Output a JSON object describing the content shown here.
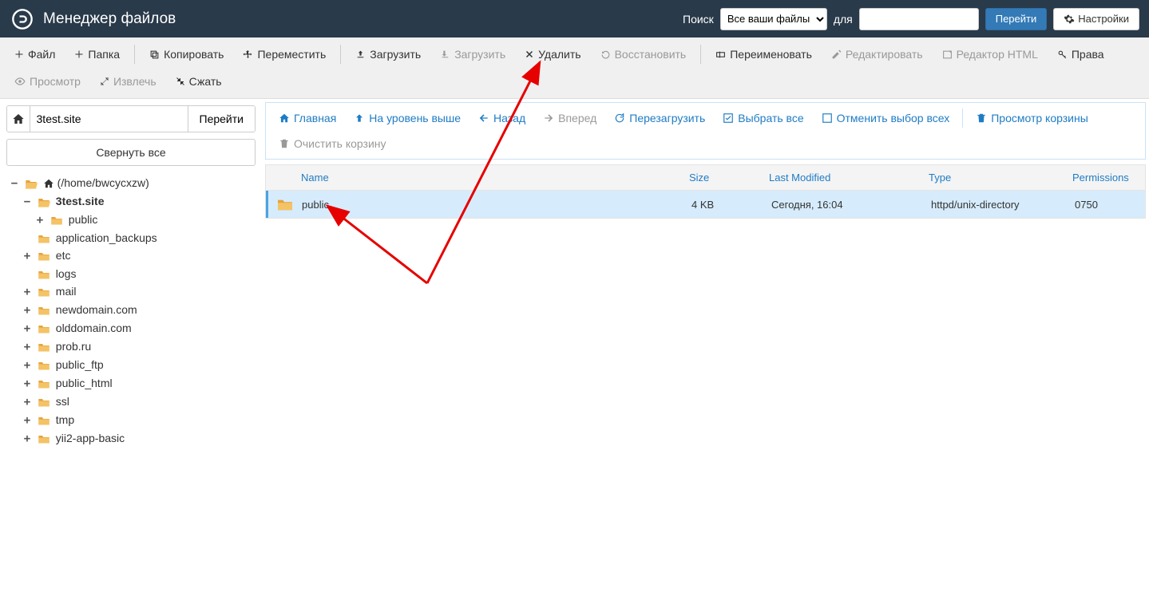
{
  "header": {
    "title": "Менеджер файлов",
    "search_label": "Поиск",
    "search_scope": "Все ваши файлы",
    "for_label": "для",
    "search_value": "",
    "go_btn": "Перейти",
    "settings_btn": "Настройки"
  },
  "toolbar": {
    "file": "Файл",
    "folder": "Папка",
    "copy": "Копировать",
    "move": "Переместить",
    "upload": "Загрузить",
    "download": "Загрузить",
    "delete": "Удалить",
    "restore": "Восстановить",
    "rename": "Переименовать",
    "edit": "Редактировать",
    "html_editor": "Редактор HTML",
    "permissions": "Права",
    "view": "Просмотр",
    "extract": "Извлечь",
    "compress": "Сжать"
  },
  "sidebar": {
    "path_value": "3test.site",
    "go_btn": "Перейти",
    "collapse_all": "Свернуть все",
    "root_label": "(/home/bwcycxzw)",
    "tree": [
      {
        "label": "3test.site",
        "bold": true,
        "expanded": true,
        "indent": 2,
        "children": [
          {
            "label": "public",
            "indent": 3,
            "toggle": "+"
          }
        ]
      },
      {
        "label": "application_backups",
        "indent": 2,
        "toggle": ""
      },
      {
        "label": "etc",
        "indent": 2,
        "toggle": "+"
      },
      {
        "label": "logs",
        "indent": 2,
        "toggle": ""
      },
      {
        "label": "mail",
        "indent": 2,
        "toggle": "+"
      },
      {
        "label": "newdomain.com",
        "indent": 2,
        "toggle": "+"
      },
      {
        "label": "olddomain.com",
        "indent": 2,
        "toggle": "+"
      },
      {
        "label": "prob.ru",
        "indent": 2,
        "toggle": "+"
      },
      {
        "label": "public_ftp",
        "indent": 2,
        "toggle": "+"
      },
      {
        "label": "public_html",
        "indent": 2,
        "toggle": "+"
      },
      {
        "label": "ssl",
        "indent": 2,
        "toggle": "+"
      },
      {
        "label": "tmp",
        "indent": 2,
        "toggle": "+"
      },
      {
        "label": "yii2-app-basic",
        "indent": 2,
        "toggle": "+"
      }
    ]
  },
  "actions": {
    "home": "Главная",
    "up": "На уровень выше",
    "back": "Назад",
    "forward": "Вперед",
    "reload": "Перезагрузить",
    "select_all": "Выбрать все",
    "unselect_all": "Отменить выбор всех",
    "view_trash": "Просмотр корзины",
    "empty_trash": "Очистить корзину"
  },
  "table": {
    "columns": {
      "name": "Name",
      "size": "Size",
      "modified": "Last Modified",
      "type": "Type",
      "permissions": "Permissions"
    },
    "rows": [
      {
        "name": "public",
        "size": "4 KB",
        "modified": "Сегодня, 16:04",
        "type": "httpd/unix-directory",
        "permissions": "0750"
      }
    ]
  }
}
